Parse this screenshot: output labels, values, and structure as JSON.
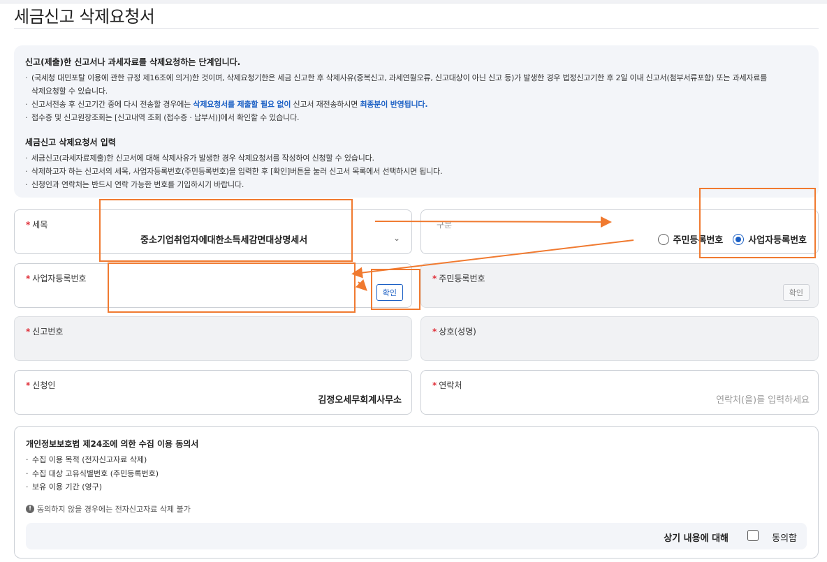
{
  "page": {
    "title": "세금신고 삭제요청서"
  },
  "info": {
    "heading1": "신고(제출)한 신고서나 과세자료를 삭제요청하는 단계입니다.",
    "bullets1": [
      "(국세청 대민포탈 이용에 관한 규정 제16조에 의거)한 것이며, 삭제요청기한은 세금 신고한 후 삭제사유(중복신고, 과세연월오류, 신고대상이 아닌 신고 등)가 발생한 경우 법정신고기한 후 2일 이내 신고서(첨부서류포함) 또는 과세자료를",
      "삭제요청할 수 있습니다.",
      "신고서전송 후 신고기간 중에 다시 전송할 경우에는 ",
      "삭제요청서를 제출할 필요 없이",
      " 신고서 재전송하시면 ",
      "최종분이 반영됩니다.",
      "접수증 및 신고원장조회는 [신고내역 조회 (접수증 · 납부서)]에서 확인할 수 있습니다."
    ],
    "heading2": "세금신고 삭제요청서 입력",
    "bullets2": [
      "세금신고(과세자료제출)한 신고서에 대해 삭제사유가 발생한 경우 삭제요청서를 작성하여 신청할 수 있습니다.",
      "삭제하고자 하는 신고서의 세목, 사업자등록번호(주민등록번호)을 입력한 후 [확인]버튼을 눌러 신고서 목록에서 선택하시면 됩니다.",
      "신청인과 연락처는 반드시 연락 가능한 번호를 기입하시기 바랍니다."
    ]
  },
  "form": {
    "req_mark": "*",
    "tax_item": {
      "label": "세목",
      "value": "중소기업취업자에대한소득세감면대상명세서",
      "chevron": "⌄"
    },
    "type": {
      "label": "구분",
      "options": [
        "주민등록번호",
        "사업자등록번호"
      ],
      "selected": "사업자등록번호"
    },
    "biz_no": {
      "label": "사업자등록번호",
      "value": "",
      "button": "확인"
    },
    "resident_no": {
      "label": "주민등록번호",
      "button": "확인"
    },
    "report_no": {
      "label": "신고번호"
    },
    "company": {
      "label": "상호(성명)"
    },
    "applicant": {
      "label": "신청인",
      "value": "김정오세무회계사무소"
    },
    "contact": {
      "label": "연락처",
      "placeholder": "연락처(을)를 입력하세요"
    }
  },
  "consent": {
    "heading": "개인정보보호법 제24조에 의한 수집 이용 동의서",
    "bullets": [
      "수집 이용 목적 (전자신고자료 삭제)",
      "수집 대상 고유식별번호 (주민등록번호)",
      "보유 이용 기간 (영구)"
    ],
    "notice_icon": "!",
    "notice": "동의하지 않을 경우에는 전자신고자료 삭제 불가",
    "agree_text": "상기 내용에 대해",
    "agree_label": "동의함"
  },
  "colors": {
    "accent": "#1a5fc4",
    "annotation": "#f07a30",
    "required": "#e0303a"
  }
}
